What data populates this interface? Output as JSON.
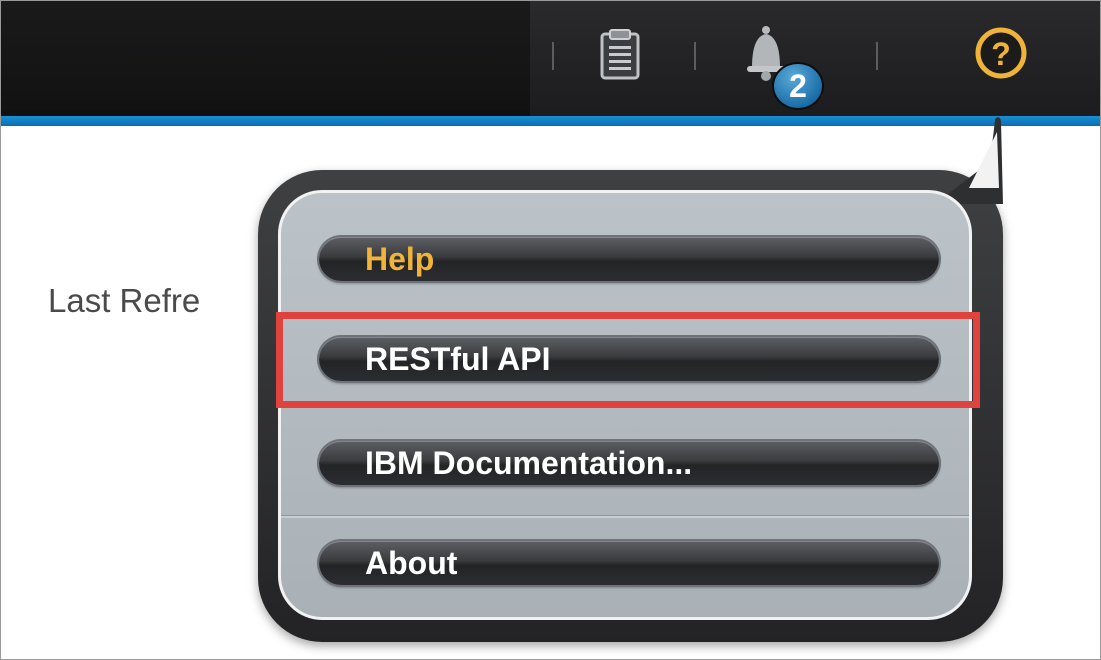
{
  "topbar": {
    "icons": {
      "clipboard": "clipboard-icon",
      "bell": "bell-icon",
      "help": "help-icon"
    },
    "notification_count": "2",
    "accent_color": "#1b8fd6"
  },
  "main": {
    "last_refresh_text": "Last Refre"
  },
  "help_menu": {
    "items": [
      {
        "label": "Help",
        "active": true
      },
      {
        "label": "RESTful API",
        "active": false,
        "highlighted": true
      },
      {
        "label": "IBM Documentation...",
        "active": false
      },
      {
        "label": "About",
        "active": false
      }
    ],
    "active_color": "#f1b43a",
    "highlight_color": "#e0433d"
  }
}
